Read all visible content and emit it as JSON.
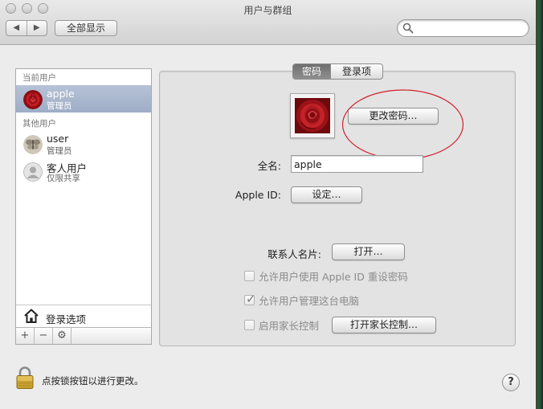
{
  "window": {
    "title": "用户与群组"
  },
  "toolbar": {
    "back_glyph": "◀",
    "forward_glyph": "▶",
    "show_all_label": "全部显示",
    "search_placeholder": ""
  },
  "sidebar": {
    "current_users_label": "当前用户",
    "current_user": {
      "name": "apple",
      "role": "管理员",
      "avatar": "red-rose"
    },
    "other_users_label": "其他用户",
    "other_users": [
      {
        "name": "user",
        "role": "管理员",
        "avatar": "butterfly"
      },
      {
        "name": "客人用户",
        "role": "仅限共享",
        "avatar": "generic-person"
      }
    ],
    "login_options_label": "登录选项",
    "tools": {
      "add": "+",
      "remove": "−",
      "gear": "⚙"
    }
  },
  "main": {
    "tabs": [
      {
        "label": "密码",
        "active": true
      },
      {
        "label": "登录项",
        "active": false
      }
    ],
    "change_password_button": "更改密码…",
    "full_name_label": "全名:",
    "full_name_value": "apple",
    "apple_id_label": "Apple ID:",
    "apple_id_button": "设定…",
    "contacts_card_label": "联系人名片:",
    "contacts_card_button": "打开…",
    "checkboxes": [
      {
        "label": "允许用户使用 Apple ID 重设密码",
        "checked": false,
        "enabled": false
      },
      {
        "label": "允许用户管理这台电脑",
        "checked": true,
        "enabled": false
      },
      {
        "label": "启用家长控制",
        "checked": false,
        "enabled": false
      }
    ],
    "parental_controls_button": "打开家长控制…"
  },
  "footer": {
    "lock_label": "点按锁按钮以进行更改。",
    "help_glyph": "?"
  },
  "colors": {
    "selection": "#a7b5cc",
    "annotation": "#d0202a",
    "window_bg": "#ececec"
  }
}
